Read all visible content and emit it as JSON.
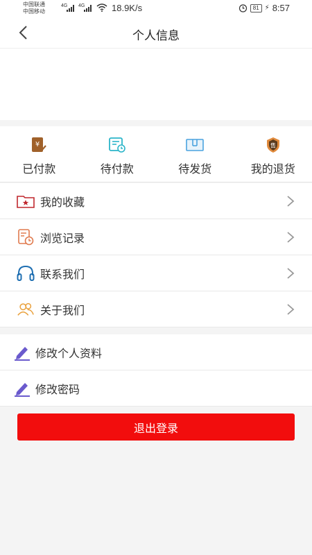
{
  "status_bar": {
    "carrier1": "中国联通",
    "carrier2": "中国移动",
    "net1": "4G",
    "net2": "4G",
    "speed": "18.9K/s",
    "battery": "81",
    "time": "8:57"
  },
  "header": {
    "title": "个人信息",
    "back_icon": "back-arrow-icon"
  },
  "orders": [
    {
      "label": "已付款",
      "icon": "paid-icon"
    },
    {
      "label": "待付款",
      "icon": "pending-payment-icon"
    },
    {
      "label": "待发货",
      "icon": "pending-shipment-icon"
    },
    {
      "label": "我的退货",
      "icon": "returns-icon"
    }
  ],
  "menu": [
    {
      "label": "我的收藏",
      "icon": "favorites-folder-icon"
    },
    {
      "label": "浏览记录",
      "icon": "history-icon"
    },
    {
      "label": "联系我们",
      "icon": "headset-icon"
    },
    {
      "label": "关于我们",
      "icon": "people-icon"
    }
  ],
  "account_menu": [
    {
      "label": "修改个人资料",
      "icon": "edit-pen-icon"
    },
    {
      "label": "修改密码",
      "icon": "edit-pen-icon"
    }
  ],
  "logout": {
    "label": "退出登录"
  },
  "colors": {
    "accent_red": "#f20d0d",
    "icon_orange": "#e08a3c",
    "icon_teal": "#2bb5c9",
    "icon_blue": "#4aa3df",
    "icon_purple": "#6a5acd"
  }
}
